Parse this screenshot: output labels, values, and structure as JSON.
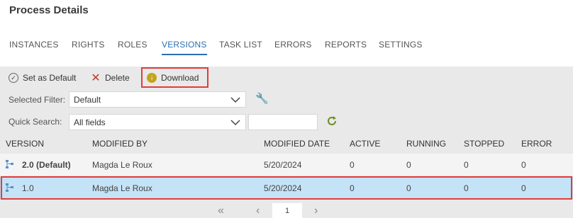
{
  "page": {
    "title": "Process Details"
  },
  "tabs": [
    "INSTANCES",
    "RIGHTS",
    "ROLES",
    "VERSIONS",
    "TASK LIST",
    "ERRORS",
    "REPORTS",
    "SETTINGS"
  ],
  "active_tab": "VERSIONS",
  "toolbar": {
    "set_default": "Set as Default",
    "delete": "Delete",
    "download": "Download"
  },
  "filters": {
    "selected_filter_label": "Selected Filter:",
    "selected_filter_value": "Default",
    "quick_search_label": "Quick Search:",
    "quick_search_field": "All fields",
    "quick_search_text": ""
  },
  "table": {
    "columns": [
      "VERSION",
      "MODIFIED BY",
      "MODIFIED DATE",
      "ACTIVE",
      "RUNNING",
      "STOPPED",
      "ERROR"
    ],
    "rows": [
      {
        "version": "2.0 (Default)",
        "modified_by": "Magda Le Roux",
        "modified_date": "5/20/2024",
        "active": "0",
        "running": "0",
        "stopped": "0",
        "error": "0"
      },
      {
        "version": "1.0",
        "modified_by": "Magda Le Roux",
        "modified_date": "5/20/2024",
        "active": "0",
        "running": "0",
        "stopped": "0",
        "error": "0"
      }
    ]
  },
  "pagination": {
    "first": "«",
    "prev": "‹",
    "page": "1",
    "next": "›"
  },
  "colors": {
    "accent": "#2a6fb0",
    "highlight": "#e23c3c",
    "selected_row": "#c4e3f6",
    "panel": "#e9e9e9"
  }
}
